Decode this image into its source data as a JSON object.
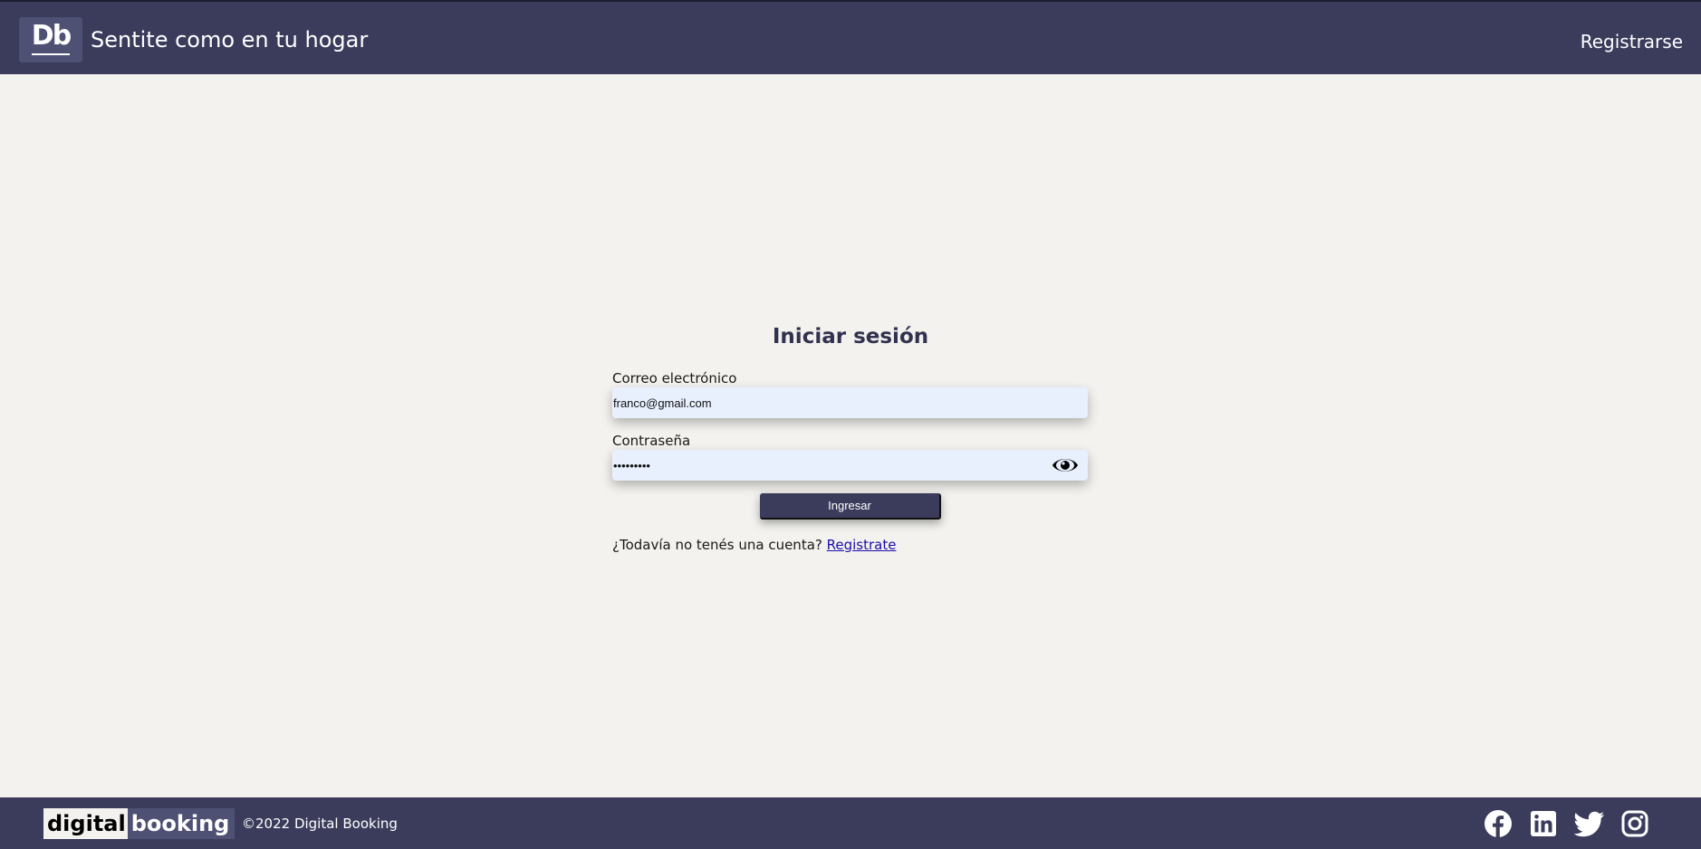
{
  "header": {
    "logo": "Db",
    "tagline": "Sentite como en tu hogar",
    "register_label": "Registrarse"
  },
  "login": {
    "title": "Iniciar sesión",
    "email_label": "Correo electrónico",
    "email_value": "franco@gmail.com",
    "password_label": "Contraseña",
    "password_value": "*********",
    "submit_label": "Ingresar",
    "signup_prompt": "¿Todavía no tenés una cuenta?",
    "signup_link": "Registrate"
  },
  "footer": {
    "logo_part_a": "digital",
    "logo_part_b": "booking",
    "copyright": "©2022 Digital Booking",
    "social_icons": [
      "facebook-icon",
      "linkedin-icon",
      "twitter-icon",
      "instagram-icon"
    ]
  },
  "colors": {
    "primary": "#3b3c5c",
    "background": "#f3f2ee",
    "input_fill": "#e8f0fe",
    "link": "#1a0dab"
  }
}
